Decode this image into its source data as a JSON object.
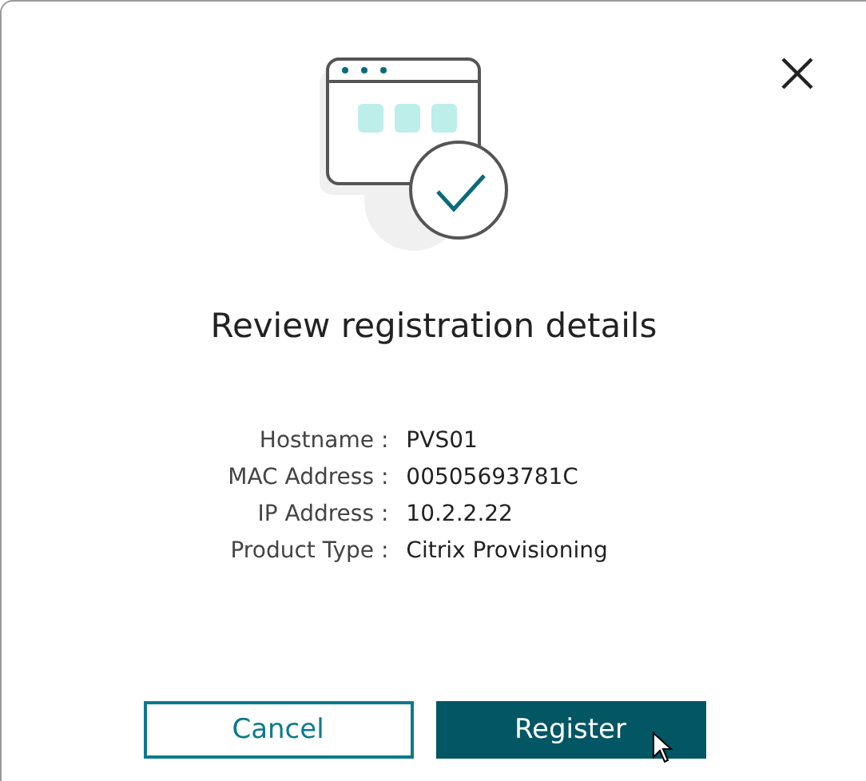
{
  "dialog": {
    "title": "Review registration details",
    "details": [
      {
        "label": "Hostname :",
        "value": "PVS01"
      },
      {
        "label": "MAC Address :",
        "value": "00505693781C"
      },
      {
        "label": "IP Address :",
        "value": "10.2.2.22"
      },
      {
        "label": "Product Type :",
        "value": "Citrix Provisioning"
      }
    ],
    "buttons": [
      {
        "label": "Cancel",
        "kind": "secondary"
      },
      {
        "label": "Register",
        "kind": "primary"
      }
    ]
  }
}
